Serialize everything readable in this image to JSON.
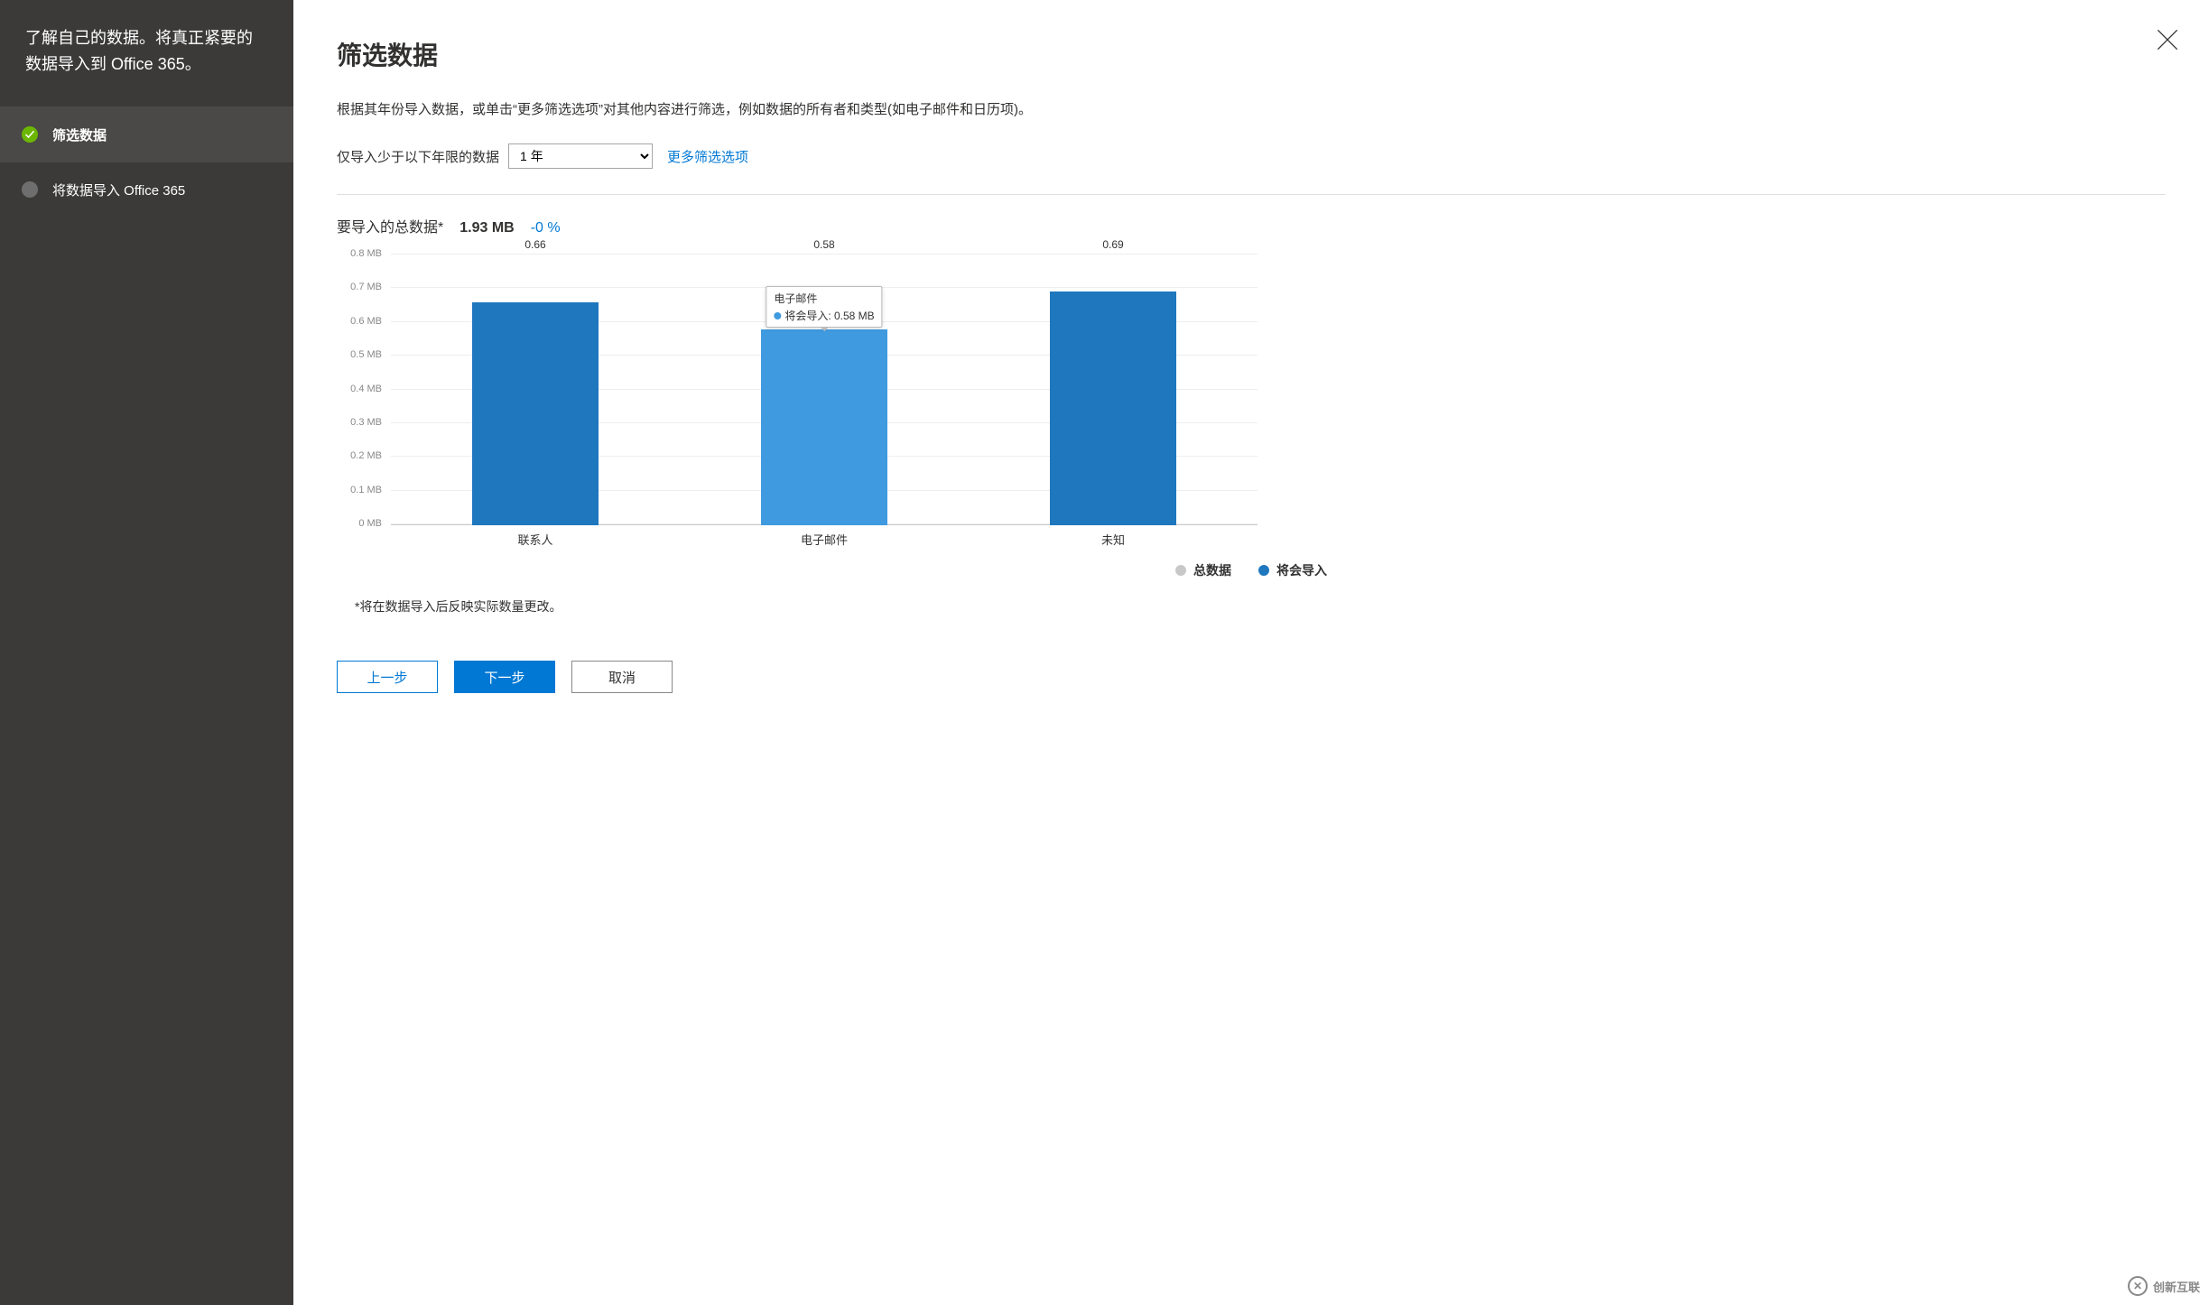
{
  "sidebar": {
    "header": "了解自己的数据。将真正紧要的数据导入到 Office 365。",
    "steps": [
      {
        "label": "筛选数据",
        "active": true,
        "done": true
      },
      {
        "label": "将数据导入 Office 365",
        "active": false,
        "done": false
      }
    ]
  },
  "header": {
    "title": "筛选数据",
    "description": "根据其年份导入数据，或单击“更多筛选选项”对其他内容进行筛选，例如数据的所有者和类型(如电子邮件和日历项)。"
  },
  "filter": {
    "label": "仅导入少于以下年限的数据",
    "selected": "1 年",
    "more_link": "更多筛选选项"
  },
  "totals": {
    "label": "要导入的总数据*",
    "value": "1.93 MB",
    "percent": "-0 %"
  },
  "chart_data": {
    "type": "bar",
    "categories": [
      "联系人",
      "电子邮件",
      "未知"
    ],
    "series": [
      {
        "name": "总数据",
        "values": [
          0.66,
          0.58,
          0.69
        ]
      },
      {
        "name": "将会导入",
        "values": [
          0.66,
          0.58,
          0.69
        ]
      }
    ],
    "value_labels": [
      "0.66",
      "0.58",
      "0.69"
    ],
    "unit": "MB",
    "ylim": [
      0,
      0.8
    ],
    "yticks": [
      "0 MB",
      "0.1 MB",
      "0.2 MB",
      "0.3 MB",
      "0.4 MB",
      "0.5 MB",
      "0.6 MB",
      "0.7 MB",
      "0.8 MB"
    ],
    "tooltip": {
      "category_index": 1,
      "series": "将会导入",
      "text": "将会导入: 0.58 MB"
    },
    "legend": [
      "总数据",
      "将会导入"
    ]
  },
  "footnote": "*将在数据导入后反映实际数量更改。",
  "buttons": {
    "back": "上一步",
    "next": "下一步",
    "cancel": "取消"
  },
  "watermark": {
    "brand": "创新互联"
  }
}
